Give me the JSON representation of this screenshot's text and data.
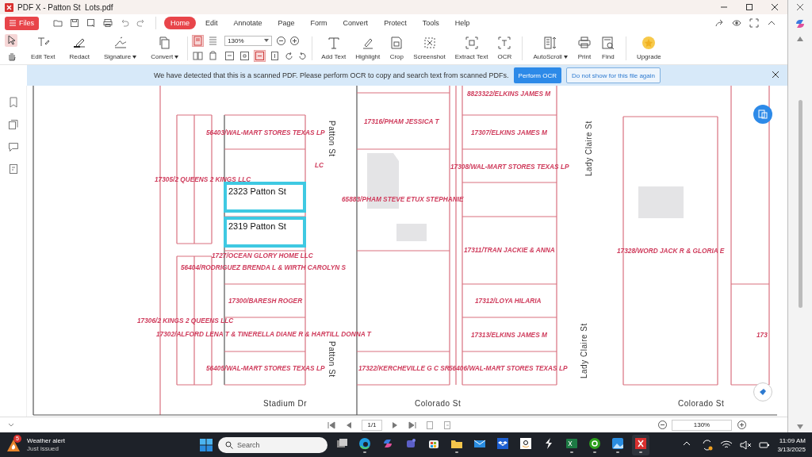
{
  "window": {
    "title": "PDF X - Patton St  Lots.pdf"
  },
  "menu": {
    "files": "Files",
    "tabs": [
      {
        "label": "Home",
        "selected": true
      },
      {
        "label": "Edit",
        "selected": false
      },
      {
        "label": "Annotate",
        "selected": false
      },
      {
        "label": "Page",
        "selected": false
      },
      {
        "label": "Form",
        "selected": false
      },
      {
        "label": "Convert",
        "selected": false
      },
      {
        "label": "Protect",
        "selected": false
      },
      {
        "label": "Tools",
        "selected": false
      },
      {
        "label": "Help",
        "selected": false
      }
    ]
  },
  "pointer_tools": [
    {
      "selected": true
    },
    {
      "selected": false
    }
  ],
  "tools_left": [
    {
      "label": "Edit Text",
      "dropdown": false
    },
    {
      "label": "Redact",
      "dropdown": false
    },
    {
      "label": "Signature",
      "dropdown": true
    },
    {
      "label": "Convert",
      "dropdown": true
    }
  ],
  "view": {
    "zoom": "130%",
    "layout_buttons": [
      {
        "selected": true
      },
      {
        "selected": false
      },
      {
        "selected": false
      },
      {
        "selected": false
      }
    ],
    "fit_buttons": [
      {
        "selected": false
      },
      {
        "selected": false
      },
      {
        "selected": true
      },
      {
        "selected": false
      }
    ]
  },
  "tools_right": [
    {
      "label": "Add Text",
      "dropdown": false
    },
    {
      "label": "Highlight",
      "dropdown": false
    },
    {
      "label": "Crop",
      "dropdown": false
    },
    {
      "label": "Screenshot",
      "dropdown": false
    },
    {
      "label": "Extract Text",
      "dropdown": false
    },
    {
      "label": "OCR",
      "dropdown": false
    },
    {
      "label": "AutoScroll",
      "dropdown": true
    },
    {
      "label": "Print",
      "dropdown": false
    },
    {
      "label": "Find",
      "dropdown": false
    },
    {
      "label": "Upgrade",
      "dropdown": false
    }
  ],
  "banner": {
    "message": "We have detected that this is a scanned PDF.  Please perform OCR to copy and search text from scanned PDFs.",
    "primary": "Perform OCR",
    "secondary": "Do not show for this file again"
  },
  "map": {
    "labels": [
      {
        "kind": "owner",
        "text": "8823322/ELKINS JAMES M"
      },
      {
        "kind": "owner",
        "text": "17316/PHAM JESSICA T"
      },
      {
        "kind": "street-down",
        "text": "Patton St"
      },
      {
        "kind": "owner",
        "text": "56403/WAL-MART STORES TEXAS LP"
      },
      {
        "kind": "owner",
        "text": "17307/ELKINS JAMES M"
      },
      {
        "kind": "street-up",
        "text": "Lady Claire St"
      },
      {
        "kind": "owner",
        "text": "LC"
      },
      {
        "kind": "owner",
        "text": "17308/WAL-MART STORES TEXAS LP"
      },
      {
        "kind": "owner",
        "text": "17305/2 QUEENS 2 KINGS LLC"
      },
      {
        "kind": "owner",
        "text": "65883/PHAM STEVE ETUX STEPHANIE"
      },
      {
        "kind": "address",
        "text": "2323 Patton St"
      },
      {
        "kind": "address",
        "text": "2319 Patton St"
      },
      {
        "kind": "owner",
        "text": "1727/OCEAN GLORY HOME LLC"
      },
      {
        "kind": "owner",
        "text": "17311/TRAN JACKIE & ANNA"
      },
      {
        "kind": "owner",
        "text": "17328/WORD JACK R & GLORIA E"
      },
      {
        "kind": "owner",
        "text": "56404/RODRIGUEZ BRENDA L & WIRTH CAROLYN S"
      },
      {
        "kind": "owner",
        "text": "17300/BARESH ROGER"
      },
      {
        "kind": "owner",
        "text": "17312/LOYA HILARIA"
      },
      {
        "kind": "owner",
        "text": "17306/2 KINGS 2 QUEENS LLC"
      },
      {
        "kind": "owner",
        "text": "17302/ALFORD LENA T & TINERELLA DIANE R & HARTILL DONNA T"
      },
      {
        "kind": "owner",
        "text": "17313/ELKINS JAMES M"
      },
      {
        "kind": "owner",
        "text": "173"
      },
      {
        "kind": "street-down",
        "text": "Patton St"
      },
      {
        "kind": "street-up",
        "text": "Lady Claire St"
      },
      {
        "kind": "owner",
        "text": "56405/WAL-MART STORES TEXAS LP"
      },
      {
        "kind": "owner",
        "text": "17322/KERCHEVILLE G C SR"
      },
      {
        "kind": "owner",
        "text": "56406/WAL-MART STORES TEXAS LP"
      },
      {
        "kind": "street",
        "text": "Stadium Dr"
      },
      {
        "kind": "street",
        "text": "Colorado St"
      },
      {
        "kind": "street",
        "text": "Colorado St"
      }
    ]
  },
  "nav": {
    "page": "1/1",
    "zoom": "130%"
  },
  "taskbar": {
    "weather": {
      "badge": "5",
      "title": "Weather alert",
      "subtitle": "Just issued"
    },
    "search": {
      "placeholder": "Search"
    },
    "apps": [
      {
        "active": true
      },
      {
        "active": false
      },
      {
        "active": false
      },
      {
        "active": false
      },
      {
        "active": true
      },
      {
        "active": false
      },
      {
        "active": false
      },
      {
        "active": false
      },
      {
        "active": false
      },
      {
        "active": true
      },
      {
        "active": true
      },
      {
        "active": true
      },
      {
        "active": true
      }
    ],
    "clock": {
      "time": "11:09 AM",
      "date": "3/13/2025"
    }
  }
}
